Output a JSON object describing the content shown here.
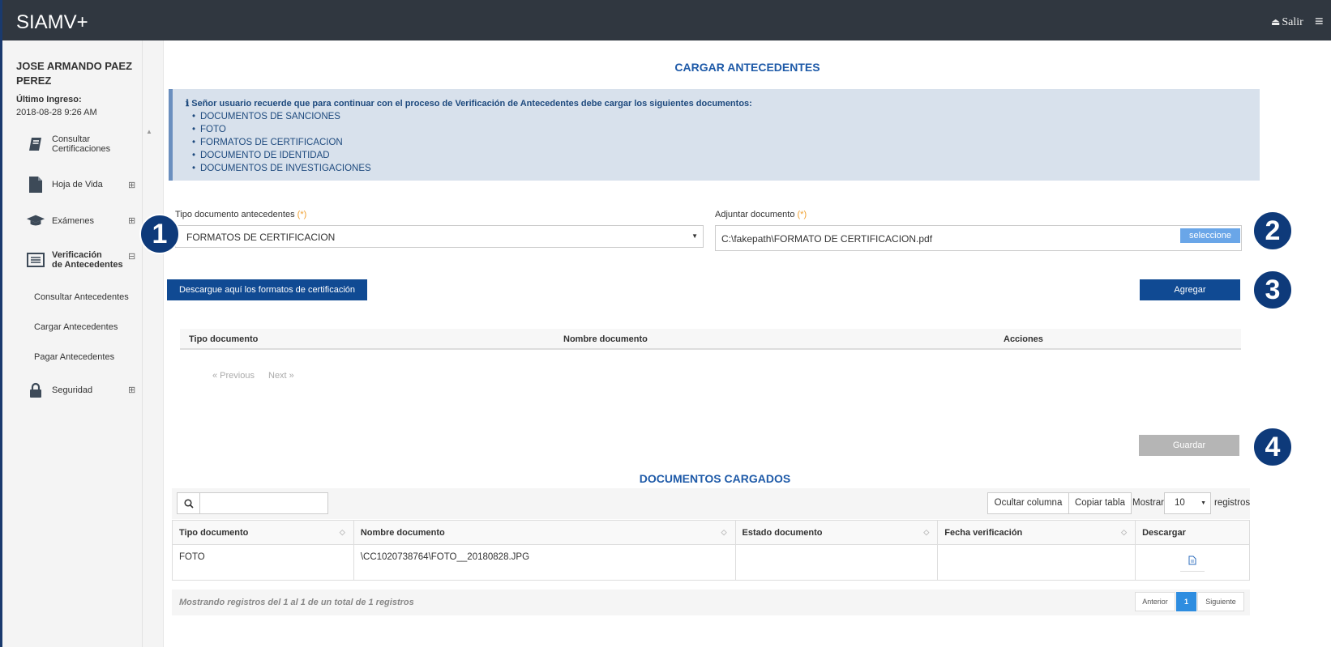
{
  "app": {
    "brand": "SIAMV+",
    "logout_label": "Salir"
  },
  "user": {
    "name": "JOSE ARMANDO PAEZ PEREZ",
    "last_login_label": "Último Ingreso:",
    "last_login_value": "2018-08-28 9:26 AM"
  },
  "sidebar": {
    "items": [
      {
        "label_line1": "Consultar",
        "label_line2": "Certificaciones",
        "icon": "book-icon"
      },
      {
        "label": "Hoja de Vida",
        "icon": "file-icon"
      },
      {
        "label": "Exámenes",
        "icon": "graduation-cap-icon"
      },
      {
        "label_line1": "Verificación",
        "label_line2": "de Antecedentes",
        "icon": "list-icon"
      },
      {
        "label": "Seguridad",
        "icon": "lock-icon"
      }
    ],
    "subitems": [
      "Consultar Antecedentes",
      "Cargar Antecedentes",
      "Pagar Antecedentes"
    ]
  },
  "main": {
    "title": "CARGAR ANTECEDENTES",
    "info": {
      "heading": "Señor usuario recuerde que para continuar con el proceso de Verificación de Antecedentes debe cargar los siguientes documentos:",
      "items": [
        "DOCUMENTOS DE SANCIONES",
        "FOTO",
        "FORMATOS DE CERTIFICACION",
        "DOCUMENTO DE IDENTIDAD",
        "DOCUMENTOS DE INVESTIGACIONES"
      ]
    },
    "form": {
      "tipo_label": "Tipo documento antecedentes",
      "required_mark": "(*)",
      "tipo_value": "FORMATOS DE CERTIFICACION",
      "adjuntar_label": "Adjuntar documento",
      "file_value": "C:\\fakepath\\FORMATO DE CERTIFICACION.pdf",
      "file_button": "seleccione"
    },
    "download_button": "Descargue aquí los formatos de certificación",
    "add_button": "Agregar",
    "table1": {
      "headers": [
        "Tipo documento",
        "Nombre documento",
        "Acciones"
      ],
      "previous": "« Previous",
      "next": "Next »"
    },
    "save_button": "Guardar",
    "badges": [
      "1",
      "2",
      "3",
      "4"
    ]
  },
  "docs": {
    "title": "DOCUMENTOS CARGADOS",
    "tools": {
      "hide_column": "Ocultar columna",
      "copy_table": "Copiar tabla",
      "show_label": "Mostrar",
      "page_length": "10",
      "records_label": "registros"
    },
    "headers": [
      "Tipo documento",
      "Nombre documento",
      "Estado documento",
      "Fecha verificación",
      "Descargar"
    ],
    "rows": [
      {
        "tipo": "FOTO",
        "nombre": "\\CC1020738764\\FOTO__20180828.JPG",
        "estado": "",
        "fecha": ""
      }
    ],
    "footer_text": "Mostrando registros del 1 al 1 de un total de 1 registros",
    "pagination": {
      "prev": "Anterior",
      "current": "1",
      "next": "Siguiente"
    }
  }
}
